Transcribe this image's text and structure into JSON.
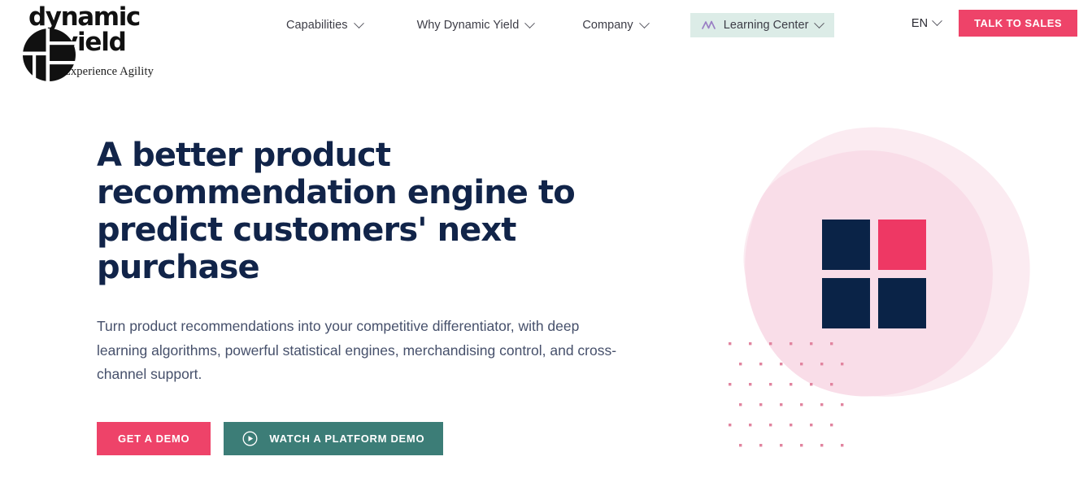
{
  "brand": {
    "name_line1": "dynamic",
    "name_line2": "yield",
    "tagline": "Experience Agility",
    "logo_mark_name": "dynamic-yield-circle-mark"
  },
  "nav": {
    "items": [
      {
        "label": "Capabilities",
        "has_dropdown": true,
        "highlighted": false,
        "icon": null
      },
      {
        "label": "Why Dynamic Yield",
        "has_dropdown": true,
        "highlighted": false,
        "icon": null
      },
      {
        "label": "Company",
        "has_dropdown": true,
        "highlighted": false,
        "icon": null
      },
      {
        "label": "Learning Center",
        "has_dropdown": true,
        "highlighted": true,
        "icon": "wave-chart-icon"
      }
    ],
    "language": "EN",
    "cta_label": "TALK TO SALES"
  },
  "hero": {
    "title": "A better product recommendation engine to predict customers' next purchase",
    "subtitle": "Turn product recommendations into your competitive differentiator, with deep learning algorithms, powerful statistical engines, merchandising control, and cross-channel support.",
    "primary_cta": "GET A DEMO",
    "secondary_cta": "WATCH A PLATFORM DEMO",
    "secondary_cta_icon": "play-circle-icon"
  },
  "colors": {
    "pink": "#ee4369",
    "pink_square": "#ee3864",
    "navy": "#0a2347",
    "heading_navy": "#112449",
    "teal_button": "#3c7d77",
    "nav_highlight_bg": "#dcece7",
    "wave_icon_purple": "#9a7fc4",
    "blob_outer": "#fbebf1",
    "blob_inner": "#f9dde8",
    "dot_pink": "#e1849f",
    "body_text": "#46506b",
    "nav_text": "#3c3c46"
  },
  "art": {
    "blob_count": 2,
    "squares": [
      {
        "position": "top-left",
        "color": "#0a2347"
      },
      {
        "position": "top-right",
        "color": "#ee3864"
      },
      {
        "position": "bottom-left",
        "color": "#0a2347"
      },
      {
        "position": "bottom-right",
        "color": "#0a2347"
      }
    ],
    "dot_grid": {
      "rows": 6,
      "cols": 6,
      "color": "#e1849f"
    }
  }
}
